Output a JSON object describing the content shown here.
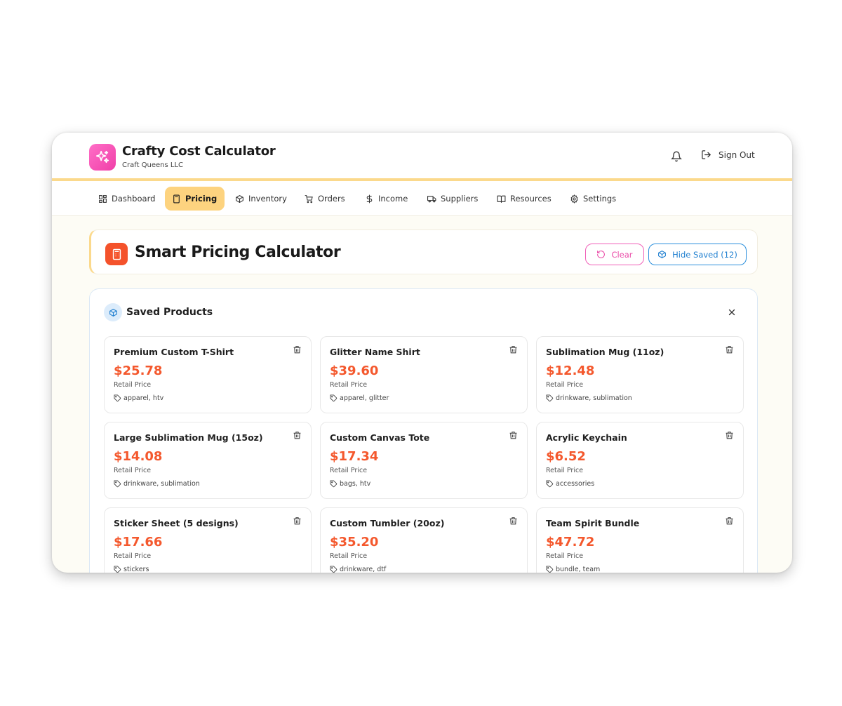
{
  "app": {
    "title": "Crafty Cost Calculator",
    "subtitle": "Craft Queens LLC",
    "sign_out": "Sign Out",
    "logo_icon": "sparkles-icon",
    "accent_pink": "#f03fa8",
    "accent_yellow": "#fbd98c"
  },
  "nav": {
    "items": [
      {
        "label": "Dashboard",
        "icon": "dashboard-icon",
        "active": false
      },
      {
        "label": "Pricing",
        "icon": "calculator-icon",
        "active": true
      },
      {
        "label": "Inventory",
        "icon": "box-icon",
        "active": false
      },
      {
        "label": "Orders",
        "icon": "cart-icon",
        "active": false
      },
      {
        "label": "Income",
        "icon": "dollar-icon",
        "active": false
      },
      {
        "label": "Suppliers",
        "icon": "truck-icon",
        "active": false
      },
      {
        "label": "Resources",
        "icon": "book-icon",
        "active": false
      },
      {
        "label": "Settings",
        "icon": "gear-icon",
        "active": false
      }
    ]
  },
  "page": {
    "title": "Smart Pricing Calculator",
    "clear_label": "Clear",
    "hide_saved_label": "Hide Saved (12)",
    "price_color": "#f4582d"
  },
  "saved": {
    "title": "Saved Products",
    "products": [
      {
        "name": "Premium Custom T-Shirt",
        "price": "$25.78",
        "label": "Retail Price",
        "tags": "apparel, htv"
      },
      {
        "name": "Glitter Name Shirt",
        "price": "$39.60",
        "label": "Retail Price",
        "tags": "apparel, glitter"
      },
      {
        "name": "Sublimation Mug (11oz)",
        "price": "$12.48",
        "label": "Retail Price",
        "tags": "drinkware, sublimation"
      },
      {
        "name": "Large Sublimation Mug (15oz)",
        "price": "$14.08",
        "label": "Retail Price",
        "tags": "drinkware, sublimation"
      },
      {
        "name": "Custom Canvas Tote",
        "price": "$17.34",
        "label": "Retail Price",
        "tags": "bags, htv"
      },
      {
        "name": "Acrylic Keychain",
        "price": "$6.52",
        "label": "Retail Price",
        "tags": "accessories"
      },
      {
        "name": "Sticker Sheet (5 designs)",
        "price": "$17.66",
        "label": "Retail Price",
        "tags": "stickers"
      },
      {
        "name": "Custom Tumbler (20oz)",
        "price": "$35.20",
        "label": "Retail Price",
        "tags": "drinkware, dtf"
      },
      {
        "name": "Team Spirit Bundle",
        "price": "$47.72",
        "label": "Retail Price",
        "tags": "bundle, team"
      }
    ]
  }
}
